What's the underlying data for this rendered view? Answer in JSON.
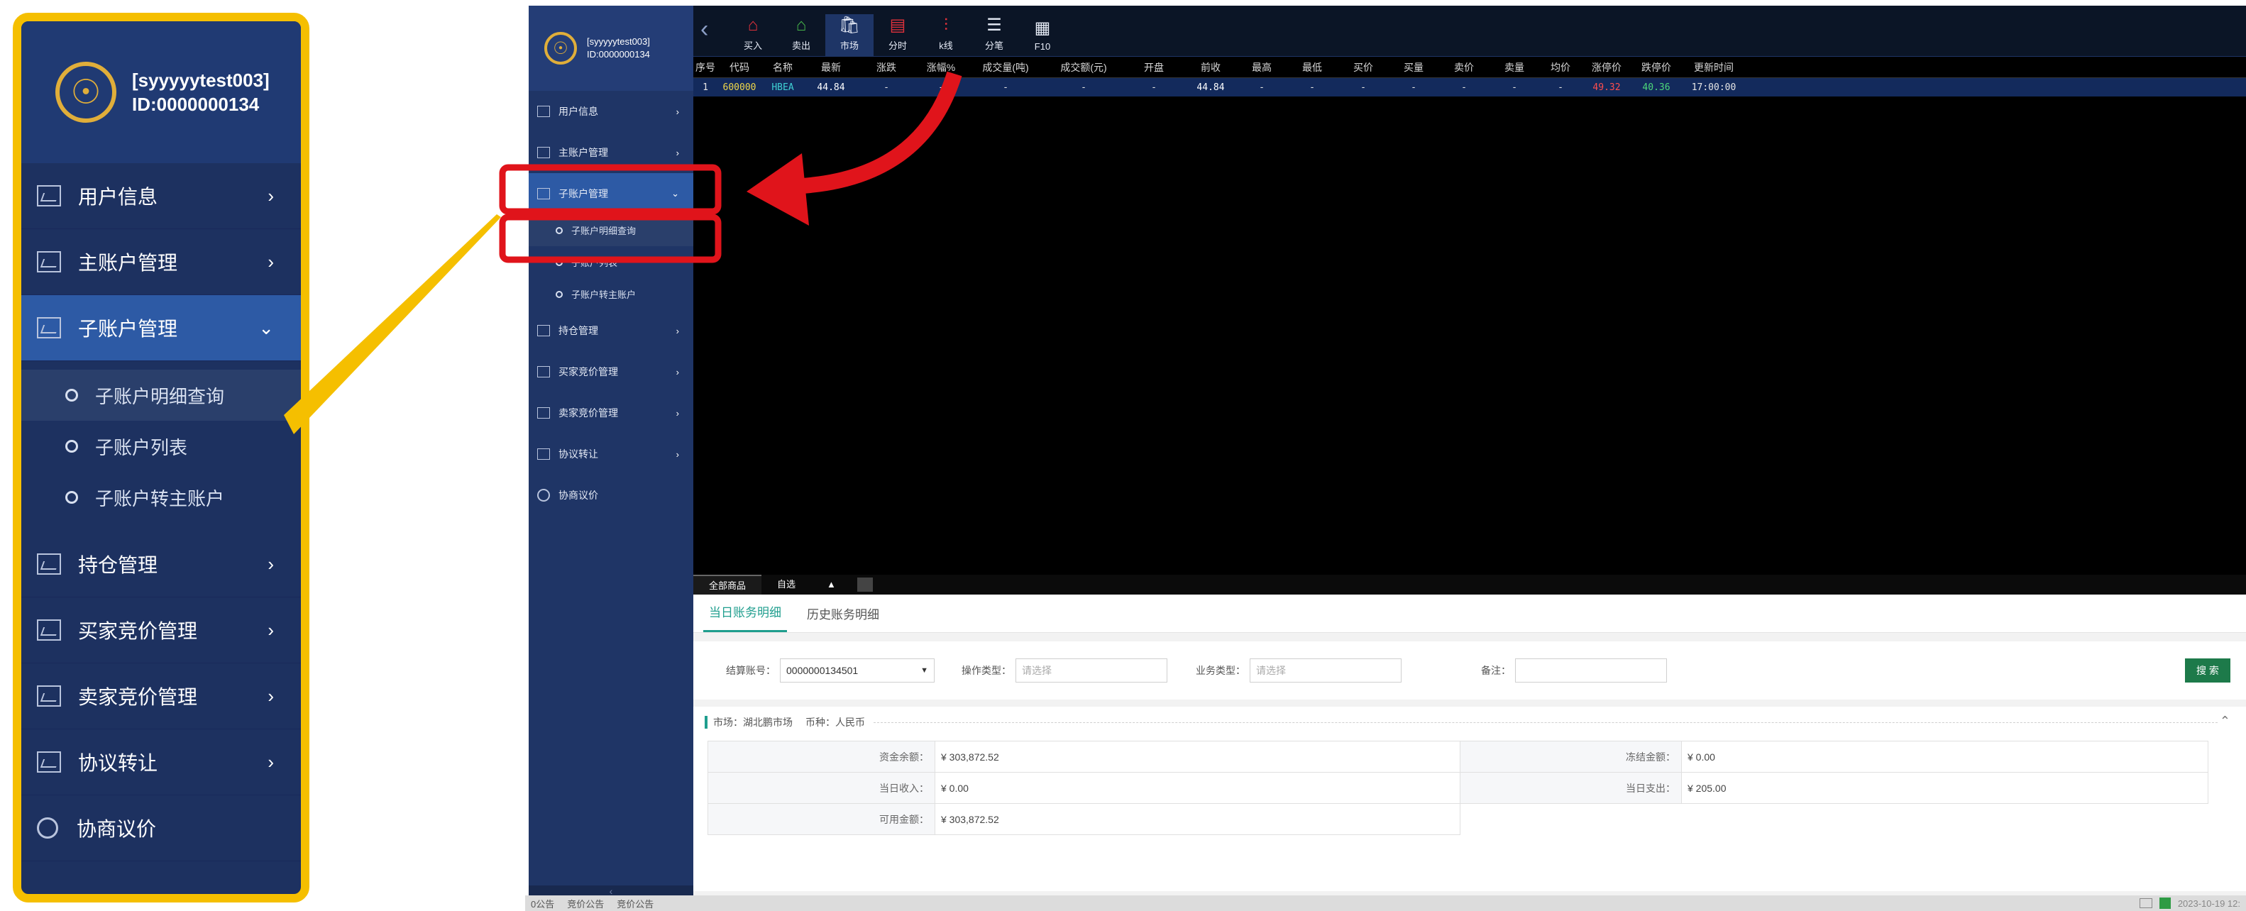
{
  "user": {
    "name": "[syyyyytest003]",
    "id": "ID:0000000134"
  },
  "logo_glyph": "☉",
  "menu": {
    "items": [
      {
        "label": "用户信息",
        "arrow": "›"
      },
      {
        "label": "主账户管理",
        "arrow": "›"
      },
      {
        "label": "子账户管理",
        "arrow": "⌄"
      },
      {
        "label": "持仓管理",
        "arrow": "›"
      },
      {
        "label": "买家竞价管理",
        "arrow": "›"
      },
      {
        "label": "卖家竞价管理",
        "arrow": "›"
      },
      {
        "label": "协议转让",
        "arrow": "›"
      },
      {
        "label": "协商议价",
        "arrow": ""
      }
    ],
    "subitems": [
      "子账户明细查询",
      "子账户列表",
      "子账户转主账户"
    ],
    "footer": "‹"
  },
  "toolbar": {
    "back": "‹",
    "buttons": [
      {
        "label": "买入",
        "glyph": "⌂",
        "color": "#e0313b"
      },
      {
        "label": "卖出",
        "glyph": "⌂",
        "color": "#46b34a"
      },
      {
        "label": "市场",
        "glyph": "🛍",
        "color": "#ffffff"
      },
      {
        "label": "分时",
        "glyph": "▤",
        "color": "#e0313b"
      },
      {
        "label": "k线",
        "glyph": "⫶",
        "color": "#e0313b"
      },
      {
        "label": "分笔",
        "glyph": "☰",
        "color": "#ffffff"
      },
      {
        "label": "F10",
        "glyph": "▦",
        "color": "#ffffff"
      }
    ]
  },
  "quote": {
    "headers": [
      "序号",
      "代码",
      "名称",
      "最新",
      "涨跌",
      "涨幅%",
      "成交量(吨)",
      "成交额(元)",
      "开盘",
      "前收",
      "最高",
      "最低",
      "买价",
      "买量",
      "卖价",
      "卖量",
      "均价",
      "涨停价",
      "跌停价",
      "更新时间"
    ],
    "row": [
      "1",
      "600000",
      "HBEA",
      "44.84",
      "-",
      "-",
      "-",
      "-",
      "-",
      "44.84",
      "-",
      "-",
      "-",
      "-",
      "-",
      "-",
      "-",
      "49.32",
      "40.36",
      "17:00:00"
    ],
    "colors": {
      "code": "#f0d84a",
      "name": "#3fd0d4",
      "up": "#ff4d4d",
      "down": "#4dd87a"
    }
  },
  "bottom_tabs": {
    "all": "全部商品",
    "fav": "自选",
    "up_arrow": "▲"
  },
  "ledger_tabs": [
    "当日账务明细",
    "历史账务明细"
  ],
  "filters": {
    "account_label": "结算账号：",
    "account_value": "0000000134501",
    "op_label": "操作类型：",
    "op_placeholder": "请选择",
    "biz_label": "业务类型：",
    "biz_placeholder": "请选择",
    "note_label": "备注：",
    "search": "搜 索",
    "caret": "▼"
  },
  "panel": {
    "market": "市场：湖北鹏市场",
    "currency": "币种：人民币",
    "collapse": "⌃",
    "rows": [
      {
        "k1": "资金余额：",
        "v1": "¥ 303,872.52",
        "k2": "冻结金额：",
        "v2": "¥ 0.00"
      },
      {
        "k1": "当日收入：",
        "v1": "¥ 0.00",
        "k2": "当日支出：",
        "v2": "¥ 205.00"
      },
      {
        "k1": "可用金额：",
        "v1": "¥ 303,872.52"
      }
    ]
  },
  "status": {
    "items": [
      "0公告",
      "竞价公告",
      "竞价公告"
    ],
    "datetime": "2023-10-19 12:"
  },
  "colors": {
    "highlight": "#e0141b",
    "callout": "#f5bf00",
    "sidebar": "#1f3566",
    "accent": "#1f9e8e"
  }
}
